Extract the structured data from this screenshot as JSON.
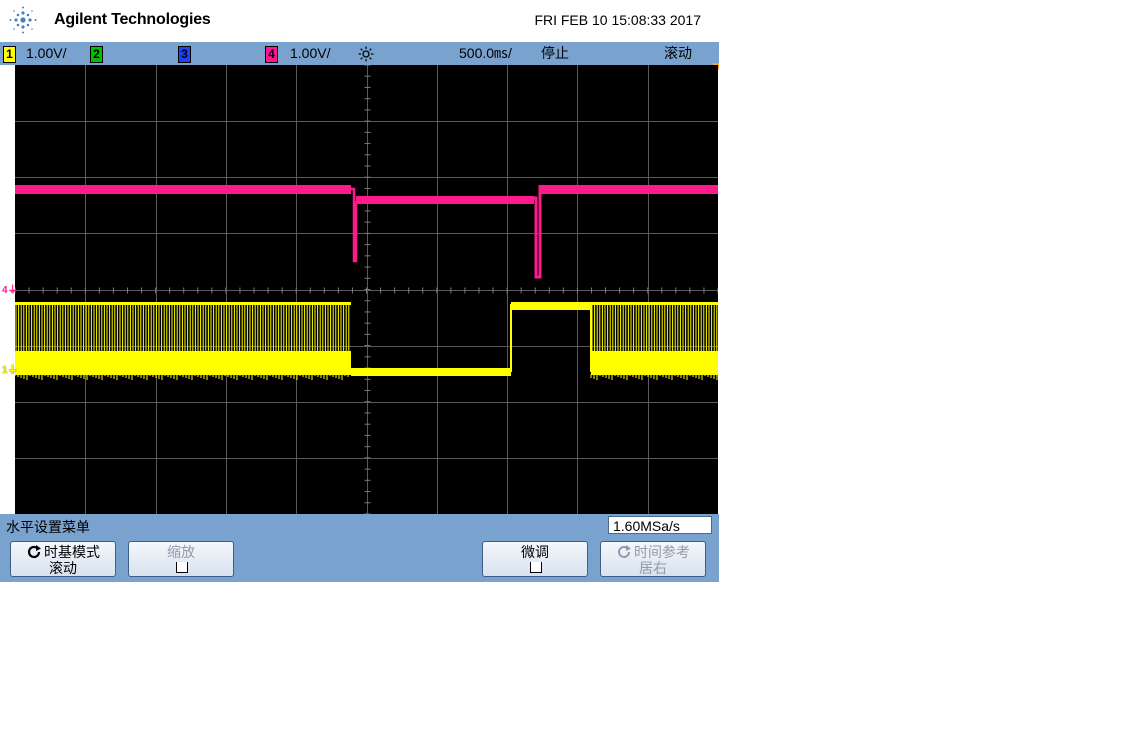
{
  "header": {
    "brand": "Agilent Technologies",
    "datetime": "FRI FEB 10 15:08:33 2017",
    "logo_icon": "agilent-spark-icon"
  },
  "status_bar": {
    "ch1": {
      "label": "1",
      "scale": "1.00V/",
      "color": "#ffff00"
    },
    "ch2": {
      "label": "2",
      "color": "#00c000"
    },
    "ch3": {
      "label": "3",
      "color": "#1e40ff"
    },
    "ch4": {
      "label": "4",
      "scale": "1.00V/",
      "color": "#ff1493"
    },
    "sun_icon": "intensity-sun-icon",
    "timebase": "500.0",
    "timebase_unit": "㎳/",
    "run_state": "停止",
    "mode": "滚动"
  },
  "screen": {
    "ch4_marker": "4",
    "ch1_marker": "1",
    "trace_colors": {
      "ch1": "#ffff00",
      "ch4": "#ff1a8c"
    }
  },
  "menu": {
    "title": "水平设置菜单",
    "sample_rate": "1.60MSa/s",
    "softkeys": [
      {
        "line1": "时基模式",
        "line2": "滚动",
        "icon": "rotate-arrow-icon"
      },
      {
        "line1": "缩放"
      },
      {
        "line1": "微调"
      },
      {
        "line1": "时间参考",
        "line2": "居右",
        "icon": "rotate-arrow-icon"
      }
    ]
  }
}
